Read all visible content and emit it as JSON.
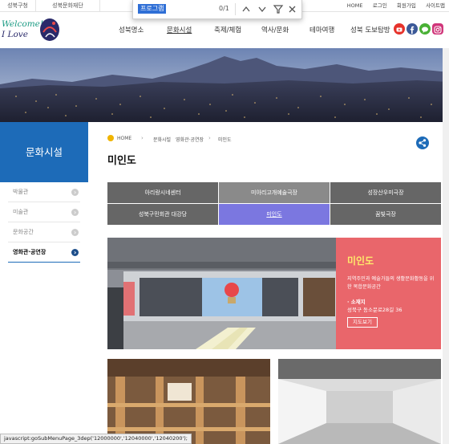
{
  "topbar": {
    "tabs": [
      "성북구청",
      "성북문화재단"
    ],
    "links": [
      "HOME",
      "로그인",
      "회원가입",
      "사이트맵"
    ]
  },
  "find_bar": {
    "query": "프로그램",
    "count": "0/1",
    "icons": [
      "chevron-up-icon",
      "chevron-down-icon",
      "filter-icon",
      "close-icon"
    ]
  },
  "logo": {
    "line1": "Welcome!",
    "line2": "I Love",
    "emblem_text": "성북"
  },
  "nav": {
    "items": [
      "성북명소",
      "문화시설",
      "축제/체험",
      "역사/문화",
      "테마여행",
      "성북 도보탐방"
    ],
    "active": "문화시설",
    "sns": [
      {
        "icon": "youtube-icon",
        "color": "#e6322b"
      },
      {
        "icon": "facebook-icon",
        "color": "#3b5998"
      },
      {
        "icon": "kakaostory-icon",
        "color": "#49b035"
      },
      {
        "icon": "instagram-icon",
        "color": "#d0367a"
      }
    ]
  },
  "sidebar": {
    "title": "문화시설",
    "items": [
      "박물관",
      "미술관",
      "문화공간",
      "영화관·공연장"
    ],
    "active_index": 3,
    "accent": "#1d6bb8"
  },
  "breadcrumb": [
    "HOME",
    "문화시설",
    "영화관·공연장",
    "미인도"
  ],
  "page_title": "미인도",
  "tabs": [
    {
      "label": "아리랑시네센터",
      "style": "dark"
    },
    {
      "label": "미아리고개예술극장",
      "style": "light"
    },
    {
      "label": "성장산우미극장",
      "style": "dark"
    },
    {
      "label": "성북구민회관 대강당",
      "style": "dark"
    },
    {
      "label": "미인도",
      "style": "selected"
    },
    {
      "label": "꿈빛극장",
      "style": "dark"
    }
  ],
  "feature": {
    "name": "미인도",
    "description": "지역주민과 예술가들의 생활문화활동을 위한 복합문화공간",
    "address_heading": "· 소재지",
    "address": "성북구 동소문로28길 36",
    "map_button": "지도보기",
    "panel_color": "#e9666b"
  },
  "status_url": "javascript:goSubMenuPage_3dep('12000000','12040000','12040200');"
}
